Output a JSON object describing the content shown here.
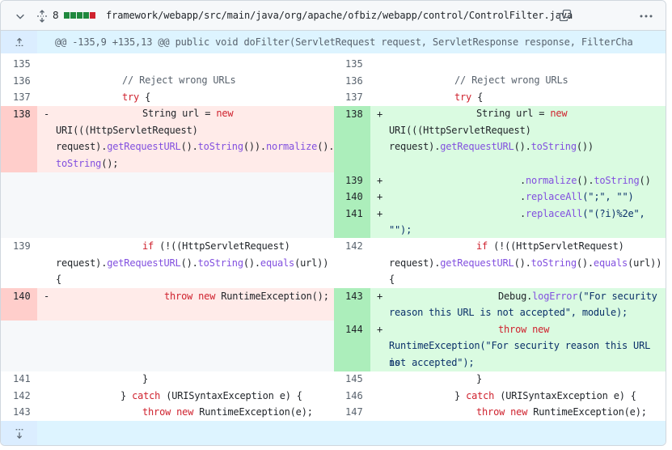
{
  "file": {
    "changes_count": "8",
    "path": "framework/webapp/src/main/java/org/apache/ofbiz/webapp/control/ControlFilter.java",
    "diffstat_colors": [
      "#1f883d",
      "#1f883d",
      "#1f883d",
      "#1f883d",
      "#cf222e"
    ]
  },
  "hunk": {
    "header": "@@ -135,9 +135,13 @@ public void doFilter(ServletRequest request, ServletResponse response, FilterCha"
  },
  "left": {
    "l135": "135",
    "l136": "136",
    "l137": "137",
    "l138": "138",
    "l139": "139",
    "l140": "140",
    "l141": "141",
    "l142": "142",
    "l143": "143"
  },
  "right": {
    "r135": "135",
    "r136": "136",
    "r137": "137",
    "r138": "138",
    "r139": "139",
    "r140": "140",
    "r141": "141",
    "r142": "142",
    "r143": "143",
    "r144": "144",
    "r145": "145",
    "r146": "146",
    "r147": "147"
  },
  "markers": {
    "del": "-",
    "add": "+"
  },
  "code": {
    "comment": "// Reject wrong URLs",
    "try": "try",
    "brace_open": " {",
    "string_url": "String url = ",
    "new": "new",
    "uri_cast": "URI(((HttpServletRequest)",
    "request": "request).",
    "getRequestURL": "getRequestURL",
    "call_close": "().",
    "toString": "toString",
    "close2": "()).",
    "normalize": "normalize",
    "end_semicolon": "();",
    "close_paren": "())",
    "dot": ".",
    "replaceAll": "replaceAll",
    "ra1_args": "(\";\", \"\")",
    "ra2_args": "(\"(?i)%2e\",",
    "ra2_tail": "\"\");",
    "open_paren": "()",
    "if": "if",
    "if_rest": " (!((HttpServletRequest)",
    "equals": "equals",
    "equals_tail": "(url))",
    "lbrace": "{",
    "throw": "throw",
    "runtime_ex_call": " RuntimeException();",
    "debug": "Debug.",
    "logError": "logError",
    "log_arg1": "(\"For security",
    "log_arg2": "reason this URL is not accepted\", module);",
    "rt_line": "RuntimeException(\"For security reason this URL is",
    "not_accepted": "not accepted\");",
    "rbrace": "}",
    "close_brace": "} ",
    "catch": "catch",
    "catch_rest": " (URISyntaxException e) {",
    "runtime_ex_e": " RuntimeException(e);"
  }
}
